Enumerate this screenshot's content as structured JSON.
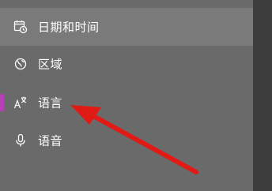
{
  "nav": {
    "items": [
      {
        "label": "日期和时间",
        "icon": "calendar-clock-icon"
      },
      {
        "label": "区域",
        "icon": "globe-region-icon"
      },
      {
        "label": "语言",
        "icon": "language-icon"
      },
      {
        "label": "语音",
        "icon": "microphone-icon"
      }
    ]
  },
  "colors": {
    "accent": "#b63fb6",
    "annotation_arrow": "#e01a14"
  }
}
